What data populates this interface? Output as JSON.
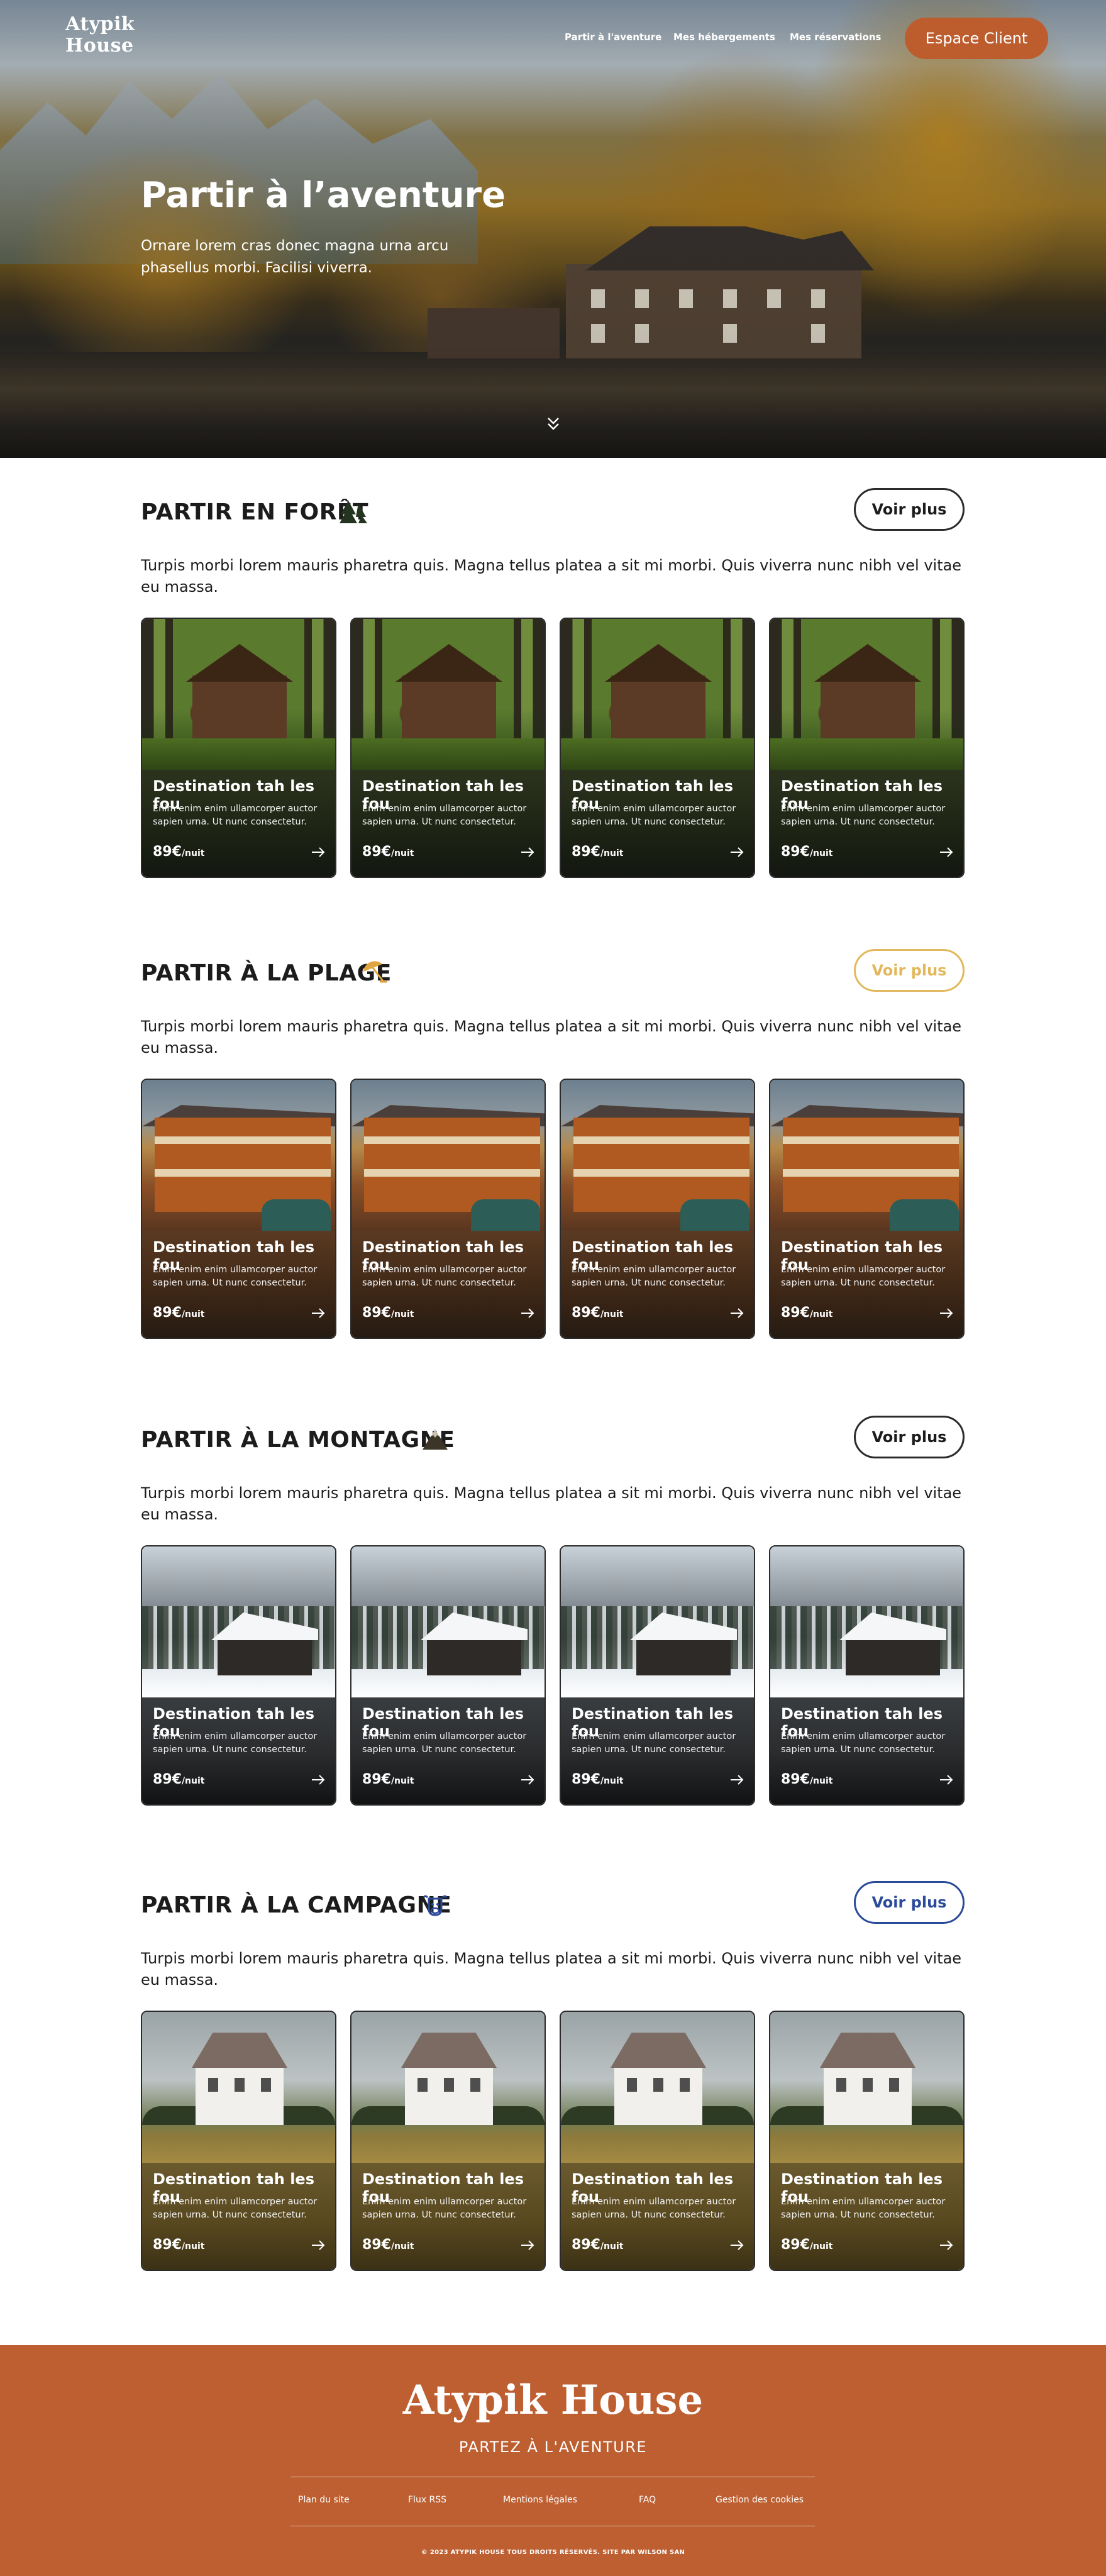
{
  "header": {
    "logo_line1": "Atypik",
    "logo_line2": "House",
    "nav": [
      "Partir à l'aventure",
      "Mes hébergements",
      "Mes réservations"
    ],
    "client_button": "Espace Client"
  },
  "hero": {
    "title": "Partir à l’aventure",
    "subtitle": "Ornare lorem cras donec magna urna arcu phasellus morbi. Facilisi viverra.",
    "scroll_icon": "double-chevron-down-icon"
  },
  "sections": [
    {
      "title": "PARTIR EN FORÊT",
      "icon": "pine-trees-icon",
      "accent": "#1f2f1e",
      "button": "Voir plus",
      "button_color": "#2b2b2b",
      "description": "Turpis morbi lorem mauris pharetra quis. Magna tellus platea a sit mi morbi. Quis viverra nunc nibh vel vitae eu massa."
    },
    {
      "title": "PARTIR À LA PLAGE",
      "icon": "beach-umbrella-icon",
      "accent": "#e0a640",
      "button": "Voir plus",
      "button_color": "#e3b85c",
      "description": "Turpis morbi lorem mauris pharetra quis. Magna tellus platea a sit mi morbi. Quis viverra nunc nibh vel vitae eu massa."
    },
    {
      "title": "PARTIR À LA MONTAGNE",
      "icon": "mountain-icon",
      "accent": "#3a3527",
      "button": "Voir plus",
      "button_color": "#2b2b2b",
      "description": "Turpis morbi lorem mauris pharetra quis. Magna tellus platea a sit mi morbi. Quis viverra nunc nibh vel vitae eu massa."
    },
    {
      "title": "PARTIR À LA CAMPAGNE",
      "icon": "cow-icon",
      "accent": "#2a4a9a",
      "button": "Voir plus",
      "button_color": "#2a4a9a",
      "description": "Turpis morbi lorem mauris pharetra quis. Magna tellus platea a sit mi morbi. Quis viverra nunc nibh vel vitae eu massa."
    }
  ],
  "card": {
    "title": "Destination tah les fou",
    "text": "Enim enim enim ullamcorper auctor sapien urna. Ut nunc consectetur.",
    "price": "89€",
    "unit": "/nuit",
    "arrow_icon": "arrow-right-icon"
  },
  "footer": {
    "logo": "Atypik House",
    "tagline": "PARTEZ À L'AVENTURE",
    "links": [
      "Plan du site",
      "Flux RSS",
      "Mentions légales",
      "FAQ",
      "Gestion des cookies"
    ],
    "copyright": "© 2023 ATYPIK HOUSE TOUS DROITS RÉSERVÉS. SITE PAR WILSON SAN"
  }
}
